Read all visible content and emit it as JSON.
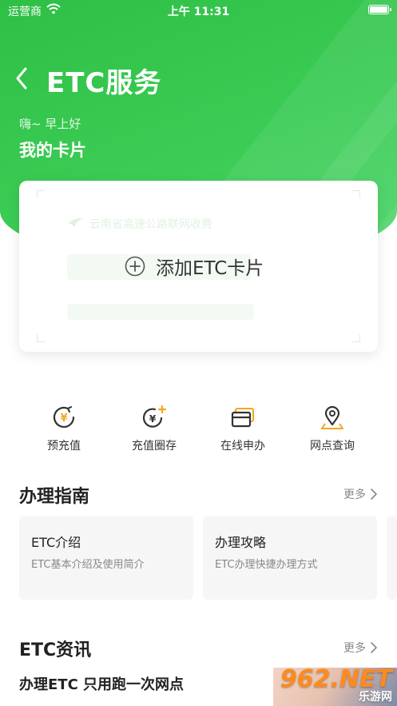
{
  "status_bar": {
    "carrier": "运营商",
    "time": "上午 11:31"
  },
  "header": {
    "title": "ETC服务"
  },
  "greeting": "嗨~ 早上好",
  "my_card": {
    "title": "我的卡片",
    "issuer": "云南省高速公路联网收费",
    "add_label": "添加ETC卡片"
  },
  "quick_actions": [
    {
      "label": "预充值",
      "icon": "yuan-refresh-icon"
    },
    {
      "label": "充值圈存",
      "icon": "yuan-plus-icon"
    },
    {
      "label": "在线申办",
      "icon": "card-icon"
    },
    {
      "label": "网点查询",
      "icon": "location-pin-icon"
    }
  ],
  "guide": {
    "title": "办理指南",
    "more": "更多",
    "items": [
      {
        "title": "ETC介绍",
        "desc": "ETC基本介绍及使用简介"
      },
      {
        "title": "办理攻略",
        "desc": "ETC办理快捷办理方式"
      }
    ]
  },
  "news": {
    "title": "ETC资讯",
    "more": "更多",
    "items": [
      {
        "title": "办理ETC  只用跑一次网点"
      }
    ]
  },
  "watermark": {
    "big": "962.NET",
    "small": "乐游网"
  },
  "colors": {
    "brand_green": "#34c34d",
    "accent_orange": "#f5a623"
  }
}
